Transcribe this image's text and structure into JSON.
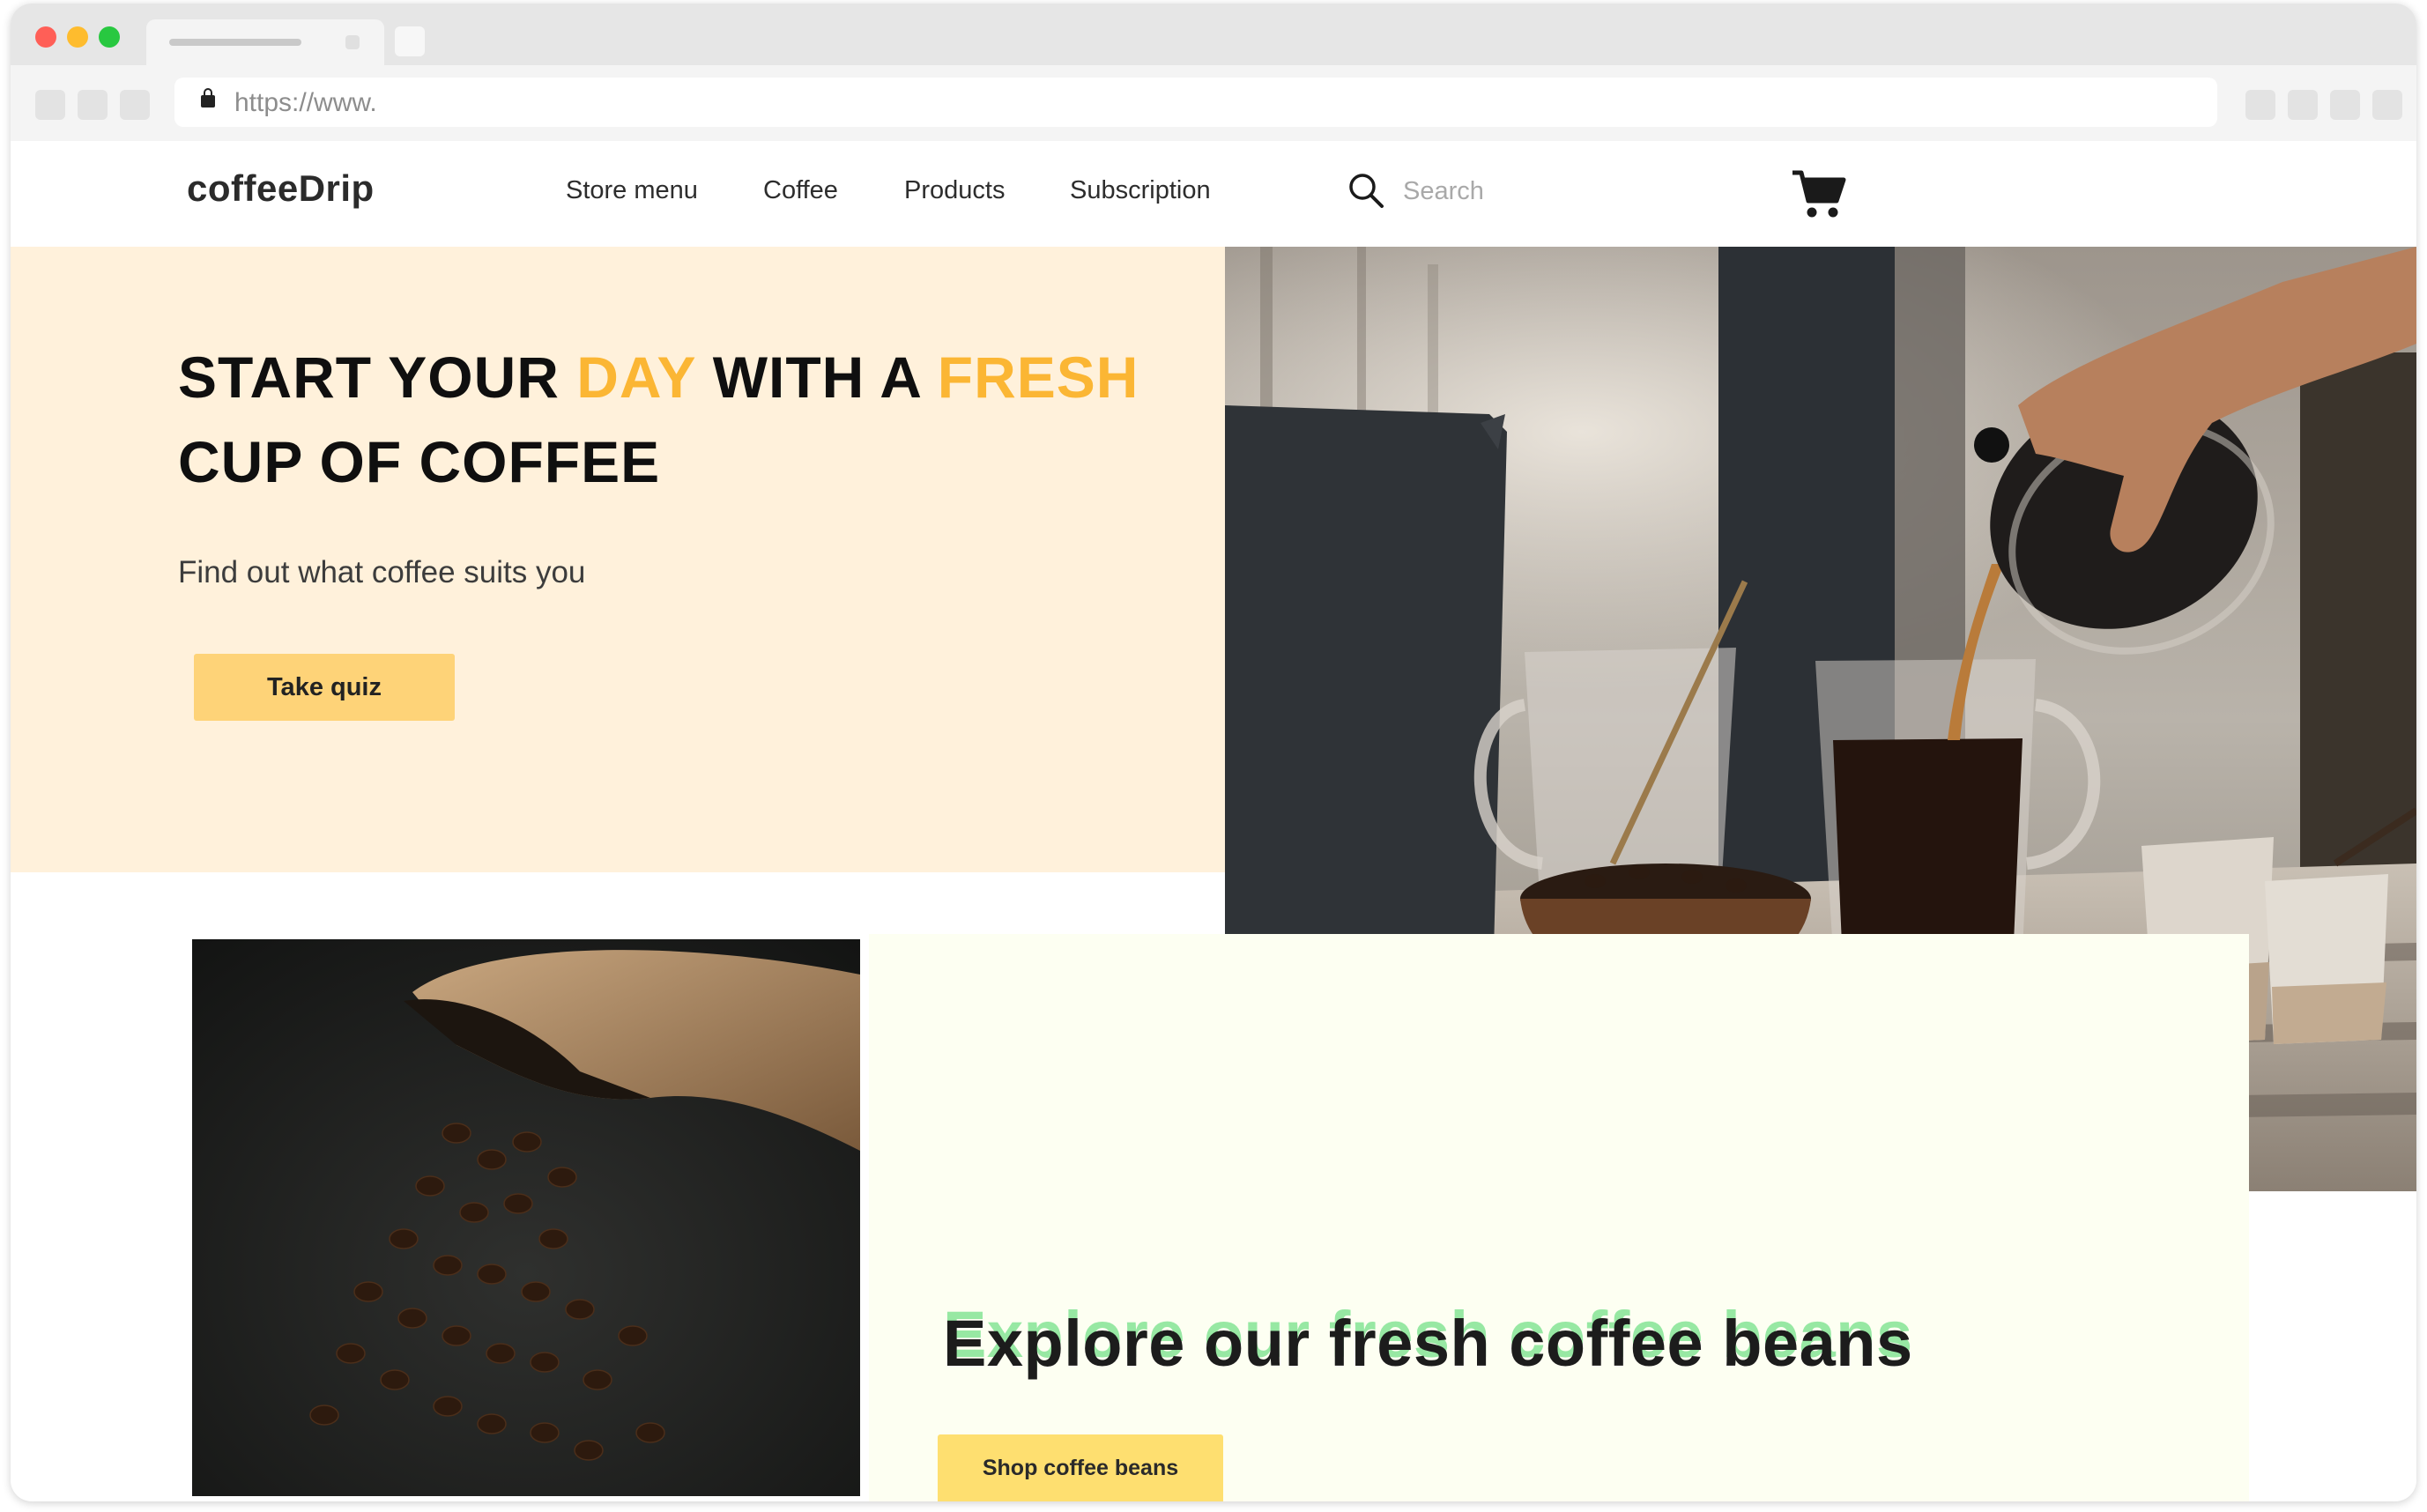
{
  "browser": {
    "url": "https://www.",
    "icons": [
      "lock-icon"
    ]
  },
  "header": {
    "logo": "coffeeDrip",
    "nav": [
      "Store menu",
      "Coffee",
      "Products",
      "Subscription"
    ],
    "search_placeholder": "Search",
    "icons": [
      "search-icon",
      "cart-icon"
    ]
  },
  "hero": {
    "title_part1": "START YOUR ",
    "title_accent1": "DAY",
    "title_part2": " WITH A ",
    "title_accent2": "FRESH",
    "title_part3": "CUP OF COFFEE",
    "subtitle": "Find out what coffee suits you",
    "cta": "Take quiz"
  },
  "explore": {
    "title": "Explore our fresh coffee beans",
    "cta": "Shop coffee beans"
  },
  "colors": {
    "accent": "#fbb634",
    "hero_bg": "#fff1db",
    "button": "#fed378",
    "explore_bg": "#fdfff2",
    "ghost_text": "#97e8a3"
  }
}
